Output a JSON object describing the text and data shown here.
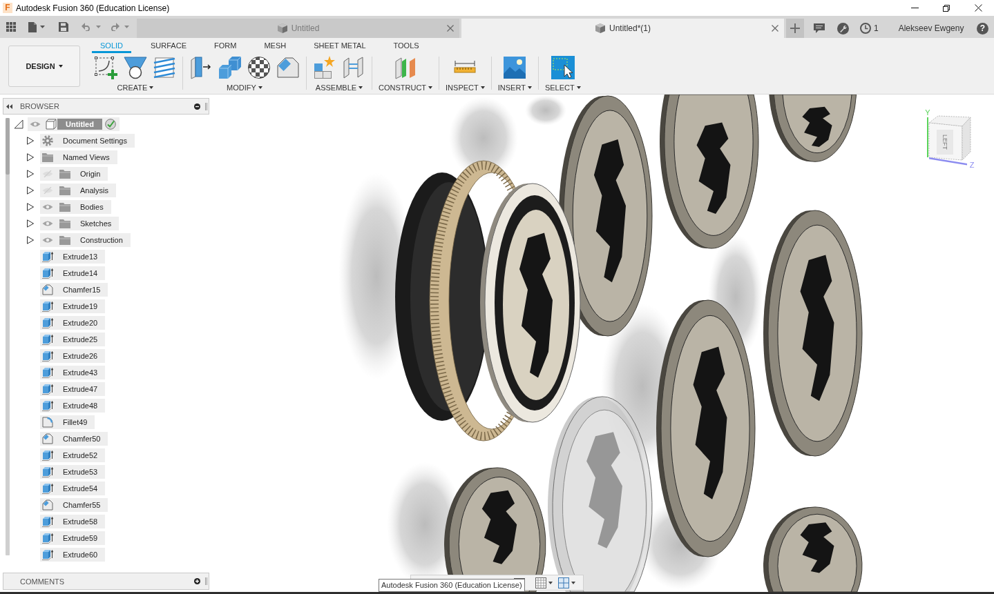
{
  "window": {
    "logo": "F",
    "title": "Autodesk Fusion 360 (Education License)"
  },
  "document_tabs": [
    {
      "title": "Untitled",
      "selected": false
    },
    {
      "title": "Untitled*(1)",
      "selected": true
    }
  ],
  "header_right": {
    "job_count": "1",
    "user": "Alekseev Ewgeny",
    "help": "?"
  },
  "ribbon": {
    "workspace": "DESIGN",
    "tabs": [
      {
        "label": "SOLID",
        "selected": true
      },
      {
        "label": "SURFACE",
        "selected": false
      },
      {
        "label": "FORM",
        "selected": false
      },
      {
        "label": "MESH",
        "selected": false
      },
      {
        "label": "SHEET METAL",
        "selected": false
      },
      {
        "label": "TOOLS",
        "selected": false
      }
    ],
    "groups": [
      {
        "label": "CREATE",
        "tools": [
          {
            "kind": "sketch",
            "active": false
          },
          {
            "kind": "hole",
            "active": false
          },
          {
            "kind": "thread",
            "active": false
          }
        ]
      },
      {
        "label": "MODIFY",
        "tools": [
          {
            "kind": "press_pull",
            "active": false
          },
          {
            "kind": "combine",
            "active": false
          },
          {
            "kind": "appearance",
            "active": false
          },
          {
            "kind": "chamfer",
            "active": false
          }
        ]
      },
      {
        "label": "ASSEMBLE",
        "tools": [
          {
            "kind": "new_component",
            "active": false
          },
          {
            "kind": "joint",
            "active": false
          }
        ]
      },
      {
        "label": "CONSTRUCT",
        "tools": [
          {
            "kind": "offset_plane",
            "active": false
          }
        ]
      },
      {
        "label": "INSPECT",
        "tools": [
          {
            "kind": "measure",
            "active": false
          }
        ]
      },
      {
        "label": "INSERT",
        "tools": [
          {
            "kind": "image",
            "active": false
          }
        ]
      },
      {
        "label": "SELECT",
        "tools": [
          {
            "kind": "select",
            "active": true
          }
        ]
      }
    ]
  },
  "browser": {
    "title": "BROWSER",
    "root": {
      "label": "Untitled",
      "expanded": true,
      "visible": true,
      "active": true,
      "children": [
        {
          "label": "Document Settings",
          "kind": "settings",
          "expanded": false
        },
        {
          "label": "Named Views",
          "kind": "views",
          "expanded": false
        },
        {
          "label": "Origin",
          "kind": "folder",
          "expanded": false,
          "visible": false
        },
        {
          "label": "Analysis",
          "kind": "folder",
          "expanded": false,
          "visible": false
        },
        {
          "label": "Bodies",
          "kind": "folder",
          "expanded": false,
          "visible": true
        },
        {
          "label": "Sketches",
          "kind": "folder",
          "expanded": false,
          "visible": true
        },
        {
          "label": "Construction",
          "kind": "folder",
          "expanded": false,
          "visible": true
        }
      ],
      "features": [
        {
          "label": "Extrude13",
          "kind": "extrude"
        },
        {
          "label": "Extrude14",
          "kind": "extrude"
        },
        {
          "label": "Chamfer15",
          "kind": "chamfer"
        },
        {
          "label": "Extrude19",
          "kind": "extrude"
        },
        {
          "label": "Extrude20",
          "kind": "extrude"
        },
        {
          "label": "Extrude25",
          "kind": "extrude"
        },
        {
          "label": "Extrude26",
          "kind": "extrude"
        },
        {
          "label": "Extrude43",
          "kind": "extrude"
        },
        {
          "label": "Extrude47",
          "kind": "extrude"
        },
        {
          "label": "Extrude48",
          "kind": "extrude"
        },
        {
          "label": "Fillet49",
          "kind": "fillet"
        },
        {
          "label": "Chamfer50",
          "kind": "chamfer"
        },
        {
          "label": "Extrude52",
          "kind": "extrude"
        },
        {
          "label": "Extrude53",
          "kind": "extrude"
        },
        {
          "label": "Extrude54",
          "kind": "extrude"
        },
        {
          "label": "Chamfer55",
          "kind": "chamfer"
        },
        {
          "label": "Extrude58",
          "kind": "extrude"
        },
        {
          "label": "Extrude59",
          "kind": "extrude"
        },
        {
          "label": "Extrude60",
          "kind": "extrude"
        }
      ]
    }
  },
  "comments": {
    "title": "COMMENTS"
  },
  "view_cube": {
    "face": "LEFT",
    "axes": [
      {
        "label": "Y",
        "color": "#5ad45a"
      },
      {
        "label": "Z",
        "color": "#8c8cf0"
      }
    ]
  },
  "tooltip": {
    "text": "Autodesk Fusion 360 (Education License)"
  }
}
